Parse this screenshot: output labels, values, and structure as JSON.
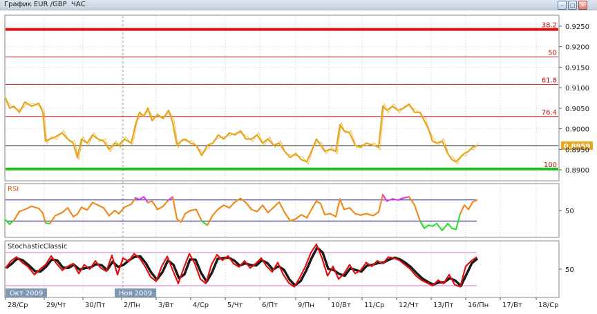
{
  "window": {
    "title": "График EUR /GBP  ЧАС",
    "buttons": [
      "minimize",
      "maximize",
      "close"
    ]
  },
  "chart_data": [
    {
      "type": "line",
      "pane": "price",
      "title": "",
      "ylim": [
        0.8875,
        0.9275
      ],
      "yticks": [
        "0.9250",
        "0.9200",
        "0.9150",
        "0.9100",
        "0.9050",
        "0.9000",
        "0.8950",
        "0.8900"
      ],
      "current_value": "0.8959",
      "color": "#e6a51c",
      "fib_levels": [
        {
          "label": "38.2",
          "value": 0.9242,
          "color": "#e01010",
          "thick": true
        },
        {
          "label": "50",
          "value": 0.9175,
          "color": "#e01010",
          "thick": false
        },
        {
          "label": "61.8",
          "value": 0.9108,
          "color": "#e01010",
          "thick": false
        },
        {
          "label": "76.4",
          "value": 0.903,
          "color": "#e01010",
          "thick": false
        },
        {
          "label": "100",
          "value": 0.8902,
          "color": "#1fbf1f",
          "thick": true
        }
      ],
      "current_line": 0.8959,
      "series": [
        {
          "x": [
            8,
            14,
            20,
            28,
            36,
            46,
            56,
            62,
            66,
            72,
            80,
            90,
            98,
            106,
            112,
            118,
            126,
            134,
            142,
            150,
            158,
            166,
            172,
            180,
            190,
            196,
            202,
            208,
            214,
            220,
            228,
            236,
            244,
            250,
            256,
            262,
            268,
            276,
            284,
            292,
            300,
            308,
            316,
            324,
            332,
            340,
            348,
            356,
            364,
            372,
            380,
            388,
            396,
            404,
            412,
            420,
            428,
            436,
            444,
            452,
            458,
            464,
            470,
            478,
            486,
            492,
            498,
            506,
            514,
            522,
            530,
            540,
            548,
            554,
            560,
            568,
            576,
            584,
            592,
            600,
            608,
            614,
            620,
            626,
            632,
            640,
            648,
            654,
            660,
            666,
            672,
            678,
            684,
            690
          ],
          "y": [
            0.9075,
            0.905,
            0.9055,
            0.904,
            0.9065,
            0.9055,
            0.9062,
            0.904,
            0.897,
            0.8975,
            0.898,
            0.899,
            0.8975,
            0.8965,
            0.893,
            0.8975,
            0.8965,
            0.8985,
            0.8975,
            0.897,
            0.895,
            0.8965,
            0.896,
            0.8975,
            0.8965,
            0.901,
            0.904,
            0.903,
            0.905,
            0.902,
            0.9035,
            0.9025,
            0.9045,
            0.9015,
            0.896,
            0.897,
            0.8975,
            0.8965,
            0.896,
            0.8935,
            0.896,
            0.8965,
            0.8985,
            0.8975,
            0.899,
            0.8985,
            0.8995,
            0.8975,
            0.8975,
            0.8985,
            0.8965,
            0.8975,
            0.896,
            0.8965,
            0.8945,
            0.893,
            0.894,
            0.8925,
            0.892,
            0.895,
            0.8975,
            0.896,
            0.8945,
            0.895,
            0.8945,
            0.901,
            0.8995,
            0.899,
            0.896,
            0.8955,
            0.8965,
            0.896,
            0.8955,
            0.9055,
            0.9045,
            0.9055,
            0.9045,
            0.905,
            0.906,
            0.904,
            0.904,
            0.902,
            0.9,
            0.897,
            0.8965,
            0.897,
            0.894,
            0.8925,
            0.892,
            0.893,
            0.894,
            0.8945,
            0.8955,
            0.8959
          ]
        }
      ]
    },
    {
      "type": "line",
      "pane": "rsi",
      "title": "RSI",
      "ylim": [
        0,
        100
      ],
      "yticks": [
        "50"
      ],
      "levels": [
        70,
        30
      ],
      "colors": {
        "main": "#f08a1e",
        "overbought": "#e040e0",
        "oversold": "#30e030",
        "level": "#1a1a8a"
      },
      "series": [
        {
          "x": [
            8,
            14,
            20,
            28,
            36,
            46,
            56,
            62,
            66,
            72,
            80,
            90,
            98,
            106,
            112,
            118,
            126,
            134,
            142,
            150,
            158,
            166,
            172,
            180,
            190,
            196,
            202,
            208,
            214,
            220,
            228,
            236,
            244,
            250,
            256,
            262,
            268,
            276,
            284,
            292,
            300,
            308,
            316,
            324,
            332,
            340,
            348,
            356,
            364,
            372,
            380,
            388,
            396,
            404,
            412,
            420,
            428,
            436,
            444,
            452,
            458,
            464,
            470,
            478,
            486,
            492,
            498,
            506,
            514,
            522,
            530,
            540,
            548,
            554,
            560,
            568,
            576,
            584,
            592,
            600,
            608,
            614,
            620,
            626,
            632,
            640,
            648,
            654,
            660,
            666,
            672,
            678,
            684,
            690
          ],
          "y": [
            32,
            24,
            31,
            48,
            52,
            58,
            54,
            45,
            26,
            25,
            40,
            46,
            55,
            38,
            43,
            56,
            51,
            65,
            60,
            55,
            40,
            50,
            44,
            56,
            62,
            74,
            71,
            76,
            65,
            68,
            52,
            58,
            70,
            76,
            34,
            28,
            44,
            50,
            52,
            30,
            22,
            41,
            53,
            60,
            55,
            66,
            73,
            65,
            52,
            48,
            60,
            46,
            56,
            66,
            46,
            30,
            34,
            42,
            36,
            55,
            68,
            63,
            42,
            44,
            38,
            72,
            52,
            55,
            44,
            41,
            44,
            40,
            47,
            80,
            68,
            72,
            70,
            74,
            76,
            60,
            30,
            16,
            22,
            20,
            25,
            12,
            25,
            16,
            14,
            44,
            60,
            52,
            66,
            70
          ]
        }
      ]
    },
    {
      "type": "line",
      "pane": "stochastic",
      "title": "StochasticClassic",
      "ylim": [
        0,
        100
      ],
      "yticks": [
        "50"
      ],
      "levels": [
        80,
        20
      ],
      "colors": {
        "main": "#e01010",
        "signal": "#1a1a1a",
        "level": "#e070c0"
      },
      "series": [
        {
          "name": "",
          "x": [
            8,
            16,
            24,
            32,
            40,
            50,
            58,
            66,
            74,
            82,
            90,
            98,
            106,
            114,
            122,
            130,
            138,
            146,
            154,
            162,
            170,
            178,
            186,
            194,
            202,
            210,
            218,
            226,
            234,
            242,
            250,
            258,
            266,
            274,
            282,
            290,
            298,
            306,
            314,
            322,
            330,
            338,
            346,
            354,
            362,
            370,
            378,
            386,
            394,
            402,
            410,
            418,
            426,
            434,
            442,
            450,
            458,
            466,
            474,
            482,
            490,
            498,
            506,
            514,
            522,
            530,
            538,
            546,
            554,
            562,
            570,
            578,
            586,
            594,
            602,
            610,
            618,
            626,
            634,
            642,
            650,
            658,
            666,
            674,
            682,
            690
          ],
          "y": [
            52,
            65,
            72,
            62,
            55,
            40,
            50,
            58,
            74,
            60,
            48,
            55,
            60,
            42,
            58,
            50,
            65,
            52,
            46,
            75,
            40,
            70,
            64,
            78,
            70,
            55,
            36,
            28,
            55,
            73,
            48,
            24,
            52,
            78,
            60,
            32,
            24,
            58,
            76,
            66,
            74,
            60,
            54,
            65,
            52,
            60,
            70,
            55,
            45,
            62,
            40,
            25,
            18,
            35,
            55,
            80,
            95,
            70,
            38,
            55,
            32,
            42,
            58,
            42,
            48,
            62,
            55,
            65,
            60,
            72,
            70,
            66,
            58,
            50,
            38,
            30,
            25,
            20,
            30,
            24,
            40,
            22,
            18,
            55,
            65,
            72
          ]
        }
      ]
    }
  ],
  "time_axis": {
    "labels": [
      "28/Ср",
      "29/Чт",
      "30/Пт",
      "2/Пн",
      "3/Вт",
      "4/Ср",
      "5/Чт",
      "6/Пт",
      "9/Пн",
      "10/Вт",
      "11/Ср",
      "12/Чт",
      "13/Пт",
      "16/Пн",
      "17/Вт",
      "18/Ср"
    ],
    "month_labels": [
      "Окт 2009",
      "Ноя 2009"
    ]
  }
}
